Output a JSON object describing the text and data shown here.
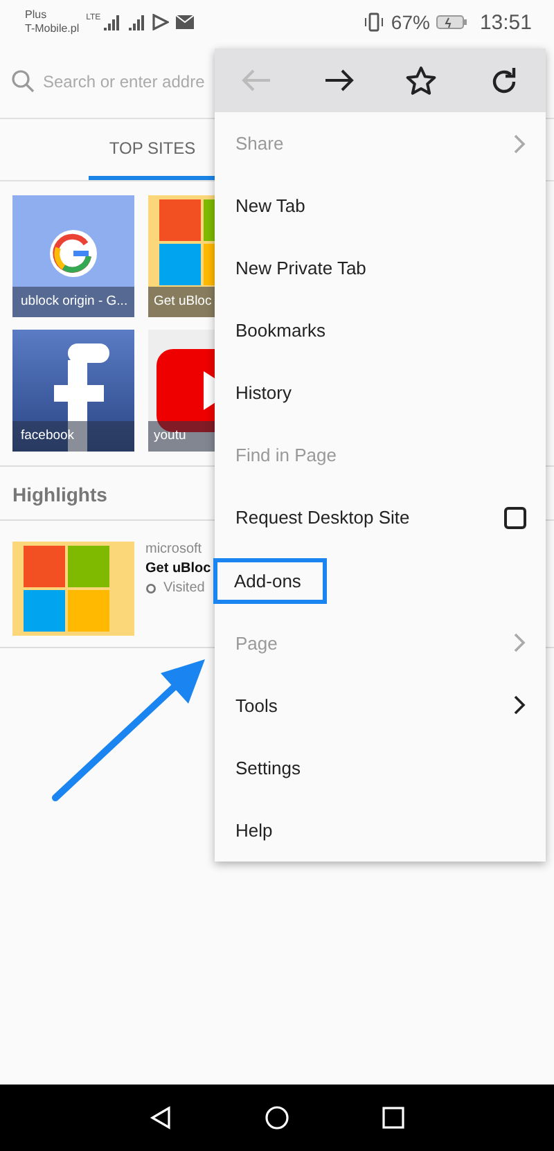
{
  "status_bar": {
    "carrier_1": "Plus",
    "carrier_2": "T-Mobile.pl",
    "network": "LTE",
    "battery": "67%",
    "time": "13:51"
  },
  "url_bar": {
    "placeholder": "Search or enter addre"
  },
  "tabs": [
    {
      "label": "TOP SITES",
      "selected": true
    }
  ],
  "top_sites": [
    {
      "label": "ublock origin - G...",
      "kind": "google"
    },
    {
      "label": "Get uBloc",
      "kind": "windows"
    },
    {
      "label": "facebook",
      "kind": "facebook"
    },
    {
      "label": "youtu",
      "kind": "youtube"
    }
  ],
  "highlights": {
    "title": "Highlights",
    "items": [
      {
        "source": "microsoft",
        "title": "Get uBloc",
        "status": "Visited",
        "kind": "windows"
      }
    ]
  },
  "menu": {
    "toolbar": [
      {
        "kind": "back",
        "disabled": true
      },
      {
        "kind": "forward",
        "disabled": false
      },
      {
        "kind": "star",
        "disabled": false
      },
      {
        "kind": "reload",
        "disabled": false
      }
    ],
    "items": [
      {
        "label": "Share",
        "disabled": true,
        "submenu": true,
        "highlighted": false
      },
      {
        "label": "New Tab",
        "disabled": false,
        "highlighted": false
      },
      {
        "label": "New Private Tab",
        "disabled": false,
        "highlighted": false
      },
      {
        "label": "Bookmarks",
        "disabled": false,
        "highlighted": false
      },
      {
        "label": "History",
        "disabled": false,
        "highlighted": false
      },
      {
        "label": "Find in Page",
        "disabled": true,
        "highlighted": false
      },
      {
        "label": "Request Desktop Site",
        "disabled": false,
        "checked": false,
        "highlighted": false
      },
      {
        "label": "Add-ons",
        "disabled": false,
        "highlighted": true
      },
      {
        "label": "Page",
        "disabled": true,
        "submenu": true,
        "highlighted": false
      },
      {
        "label": "Tools",
        "disabled": false,
        "submenu": true,
        "highlighted": false
      },
      {
        "label": "Settings",
        "disabled": false,
        "highlighted": false
      },
      {
        "label": "Help",
        "disabled": false,
        "highlighted": false
      }
    ]
  }
}
